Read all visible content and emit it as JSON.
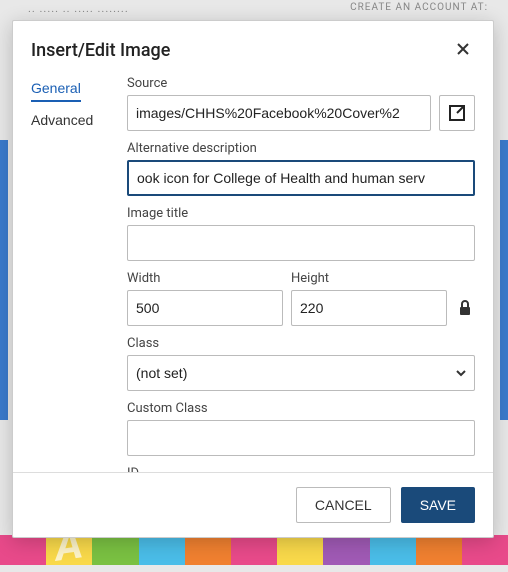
{
  "modal": {
    "title": "Insert/Edit Image",
    "tabs": {
      "general": "General",
      "advanced": "Advanced"
    },
    "labels": {
      "source": "Source",
      "alt": "Alternative description",
      "image_title": "Image title",
      "width": "Width",
      "height": "Height",
      "class": "Class",
      "custom_class": "Custom Class",
      "id": "ID"
    },
    "values": {
      "source": "images/CHHS%20Facebook%20Cover%2",
      "alt": "ook icon for College of Health and human serv",
      "image_title": "",
      "width": "500",
      "height": "220",
      "class": "(not set)",
      "custom_class": "",
      "id": ""
    },
    "buttons": {
      "cancel": "CANCEL",
      "save": "SAVE"
    }
  }
}
